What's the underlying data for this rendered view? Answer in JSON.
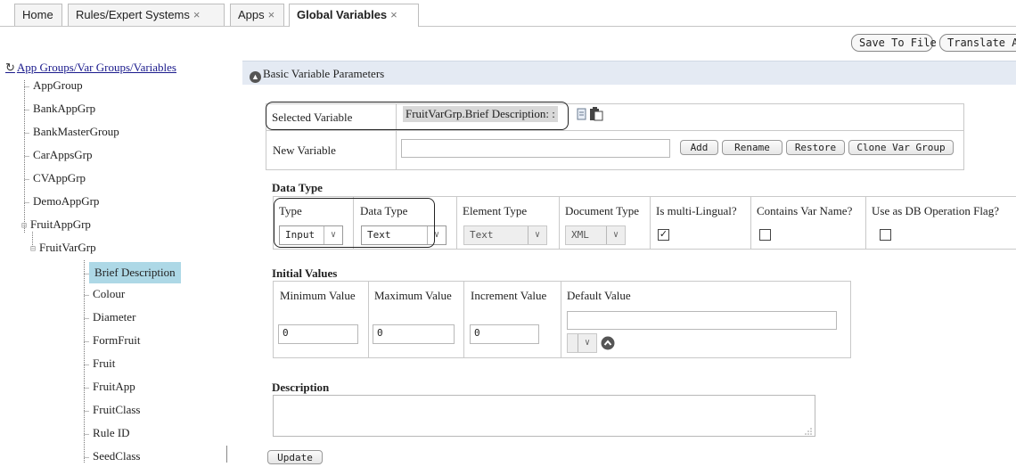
{
  "tabs": [
    {
      "label": "Home",
      "closable": false
    },
    {
      "label": "Rules/Expert Systems",
      "closable": true
    },
    {
      "label": "Apps",
      "closable": true
    },
    {
      "label": "Global Variables",
      "closable": true,
      "active": true
    }
  ],
  "tab_close_glyph": "×",
  "toolbar": {
    "save_to_file": "Save To File",
    "translate_all": "Translate All"
  },
  "tree": {
    "root_label": "App Groups/Var Groups/Variables",
    "app_groups": [
      "AppGroup",
      "BankAppGrp",
      "BankMasterGroup",
      "CarAppsGrp",
      "CVAppGrp",
      "DemoAppGrp",
      "FruitAppGrp"
    ],
    "var_group": "FruitVarGrp",
    "variables": [
      "Brief Description",
      "Colour",
      "Diameter",
      "FormFruit",
      "Fruit",
      "FruitApp",
      "FruitClass",
      "Rule ID",
      "SeedClass"
    ],
    "selected_variable": "Brief Description"
  },
  "panel": {
    "title": "Basic Variable Parameters",
    "selected_variable_label": "Selected Variable",
    "selected_variable_value": "FruitVarGrp.Brief Description: :",
    "new_variable_label": "New Variable",
    "new_variable_value": "",
    "buttons": {
      "add": "Add",
      "rename": "Rename",
      "restore": "Restore",
      "clone": "Clone Var Group"
    },
    "data_type_section": "Data Type",
    "columns": {
      "type": "Type",
      "data_type": "Data Type",
      "element_type": "Element Type",
      "document_type": "Document Type",
      "multi_lingual": "Is multi-Lingual?",
      "contains_var_name": "Contains Var Name?",
      "db_flag": "Use as DB Operation Flag?"
    },
    "values": {
      "type": "Input",
      "data_type": "Text",
      "element_type": "Text",
      "document_type": "XML",
      "multi_lingual": true,
      "contains_var_name": false,
      "db_flag": false
    },
    "initial_values_section": "Initial Values",
    "initial": {
      "min_label": "Minimum Value",
      "max_label": "Maximum Value",
      "inc_label": "Increment Value",
      "default_label": "Default Value",
      "min": "0",
      "max": "0",
      "inc": "0",
      "default": ""
    },
    "description_section": "Description",
    "description": "",
    "update_button": "Update"
  },
  "colors": {
    "selected_bg": "#add8e6",
    "panel_header_bg": "#e4eaf3",
    "callout_border": "#222222"
  }
}
